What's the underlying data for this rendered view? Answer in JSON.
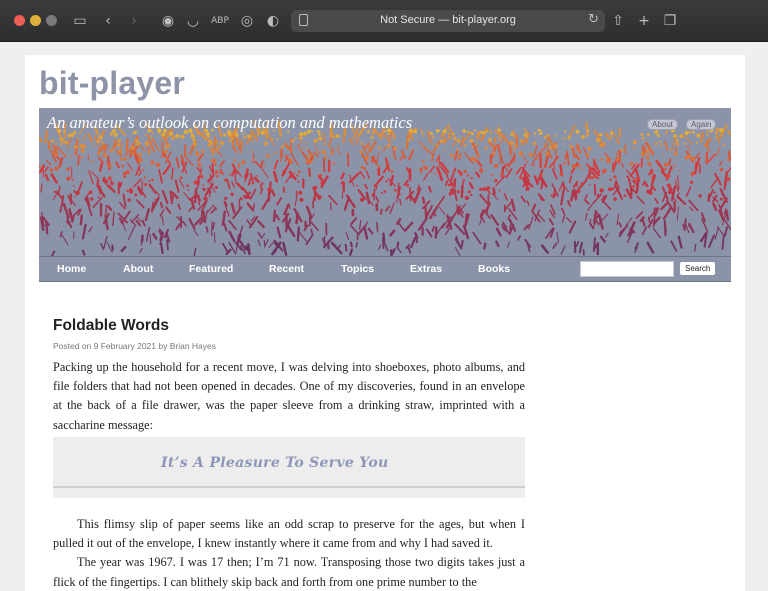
{
  "browser": {
    "url_text": "Not Secure — bit-player.org",
    "icons": [
      "sidebar-icon",
      "back-icon",
      "forward-icon",
      "privacy-icon",
      "pocket-icon",
      "adblock-icon",
      "extension-icon",
      "shield-icon",
      "page-icon",
      "reload-icon",
      "share-icon",
      "new-tab-icon",
      "tab-overview-icon"
    ]
  },
  "site": {
    "title": "bit-player",
    "tagline": "An amateur’s outlook on computation and mathematics",
    "about_label": "About",
    "again_label": "Again"
  },
  "nav": {
    "items": [
      "Home",
      "About",
      "Featured",
      "Recent",
      "Topics",
      "Extras",
      "Books"
    ],
    "search_value": "",
    "search_button": "Search"
  },
  "post": {
    "title": "Foldable Words",
    "meta": "Posted on 9 February 2021 by Brian Hayes",
    "paragraph1": "Packing up the household for a recent move, I was delving into shoeboxes, photo albums, and file folders that had not been opened in decades. One of my discoveries, found in an envelope at the back of a file drawer, was the paper sleeve from a drinking straw, imprinted with a saccharine message:",
    "straw_text": "It’s A Pleasure To Serve You",
    "paragraph2": "This flimsy slip of paper seems like an odd scrap to preserve for the ages, but when I pulled it out of the envelope, I knew instantly where it came from and why I had saved it.",
    "paragraph3": "The year was 1967. I was 17 then; I’m 71 now. Transposing those two digits takes just a flick of the fingertips. I can blithely skip back and forth from one prime number to the"
  },
  "colors": {
    "chrome": "#2e2e30",
    "title": "#8f93a8",
    "banner": "#8b93a8",
    "plant_top": "#e6cf3a",
    "plant_mid": "#d0373e",
    "plant_bottom": "#6a3566"
  }
}
